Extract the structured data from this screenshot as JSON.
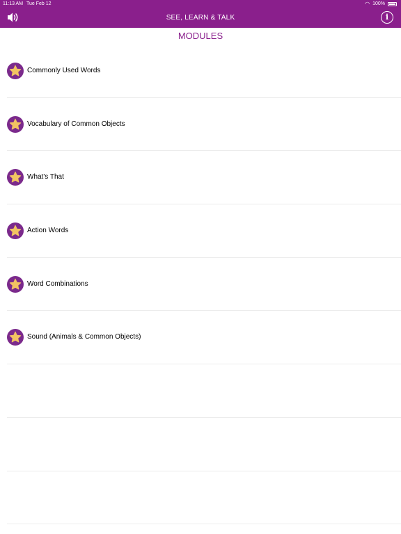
{
  "status_bar": {
    "time": "11:13 AM",
    "date": "Tue Feb 12",
    "battery": "100%"
  },
  "nav": {
    "title": "SEE, LEARN & TALK",
    "left_icon": "speaker-icon",
    "right_icon": "info-icon",
    "info_glyph": "i"
  },
  "heading": "MODULES",
  "modules": [
    {
      "label": "Commonly Used Words",
      "icon": "star-icon"
    },
    {
      "label": "Vocabulary of Common Objects",
      "icon": "star-icon"
    },
    {
      "label": "What's That",
      "icon": "star-icon"
    },
    {
      "label": "Action Words",
      "icon": "star-icon"
    },
    {
      "label": "Word Combinations",
      "icon": "star-icon"
    },
    {
      "label": "Sound (Animals & Common Objects)",
      "icon": "star-icon"
    }
  ],
  "colors": {
    "header": "#8a1f8c",
    "badge": "#7b2a8c",
    "star": "#f2c462",
    "heading_text": "#8a1f8c"
  }
}
